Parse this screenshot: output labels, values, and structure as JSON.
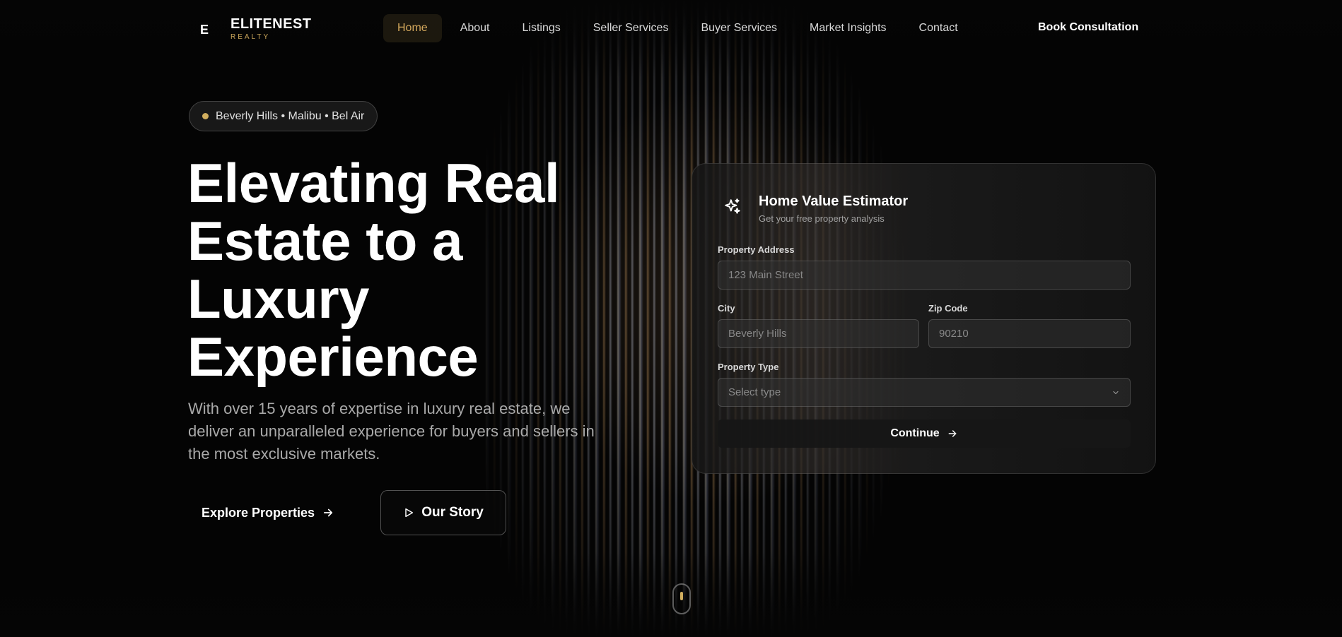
{
  "nav": {
    "logo_mark": "E",
    "logo_name": "ELITENEST",
    "logo_sub": "REALTY",
    "links": [
      {
        "label": "Home",
        "active": true
      },
      {
        "label": "About"
      },
      {
        "label": "Listings"
      },
      {
        "label": "Seller Services"
      },
      {
        "label": "Buyer Services"
      },
      {
        "label": "Market Insights"
      },
      {
        "label": "Contact"
      }
    ],
    "cta": "Book Consultation"
  },
  "hero": {
    "badge": "Beverly Hills • Malibu • Bel Air",
    "title_lines": [
      "Elevating Real",
      "Estate to a",
      "Luxury",
      "Experience"
    ],
    "description": "With over 15 years of expertise in luxury real estate, we deliver an unparalleled experience for buyers and sellers in the most exclusive markets.",
    "primary_button": "Explore Properties",
    "secondary_button": "Our Story"
  },
  "estimator": {
    "title": "Home Value Estimator",
    "subtitle": "Get your free property analysis",
    "address_label": "Property Address",
    "address_placeholder": "123 Main Street",
    "city_label": "City",
    "city_placeholder": "Beverly Hills",
    "zip_label": "Zip Code",
    "zip_placeholder": "90210",
    "type_label": "Property Type",
    "type_selected": "Select type",
    "continue_button": "Continue"
  },
  "colors": {
    "accent": "#d4a85c",
    "background": "#050505"
  }
}
